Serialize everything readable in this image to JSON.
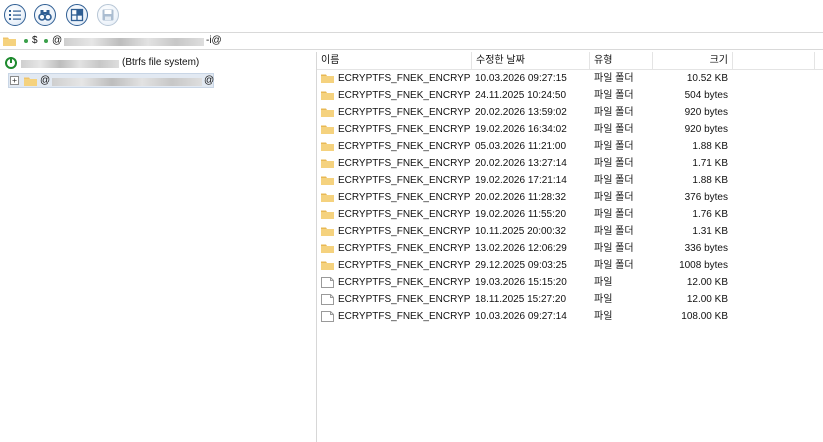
{
  "toolbar": {
    "buttons": [
      {
        "name": "list-view-button",
        "icon": "list-icon"
      },
      {
        "name": "find-button",
        "icon": "binoculars-icon"
      },
      {
        "name": "grid-view-button",
        "icon": "grid-icon"
      },
      {
        "name": "save-button",
        "icon": "floppy-disk-icon"
      }
    ]
  },
  "pathbar": {
    "separator": "$",
    "prefix": "@",
    "suffix": "-i@"
  },
  "tree": {
    "root_label": "(Btrfs file system)",
    "child_prefix": "@",
    "child_suffix": "@"
  },
  "columns": {
    "name": "이름",
    "modified": "수정한 날짜",
    "type": "유형",
    "size": "크기"
  },
  "files": [
    {
      "name": "ECRYPTFS_FNEK_ENCRYPT...",
      "modified": "10.03.2026 09:27:15",
      "type": "파일 폴더",
      "size": "10.52 KB",
      "kind": "folder"
    },
    {
      "name": "ECRYPTFS_FNEK_ENCRYPT...",
      "modified": "24.11.2025 10:24:50",
      "type": "파일 폴더",
      "size": "504 bytes",
      "kind": "folder"
    },
    {
      "name": "ECRYPTFS_FNEK_ENCRYPT...",
      "modified": "20.02.2026 13:59:02",
      "type": "파일 폴더",
      "size": "920 bytes",
      "kind": "folder"
    },
    {
      "name": "ECRYPTFS_FNEK_ENCRYPT...",
      "modified": "19.02.2026 16:34:02",
      "type": "파일 폴더",
      "size": "920 bytes",
      "kind": "folder"
    },
    {
      "name": "ECRYPTFS_FNEK_ENCRYPT...",
      "modified": "05.03.2026 11:21:00",
      "type": "파일 폴더",
      "size": "1.88 KB",
      "kind": "folder"
    },
    {
      "name": "ECRYPTFS_FNEK_ENCRYPT...",
      "modified": "20.02.2026 13:27:14",
      "type": "파일 폴더",
      "size": "1.71 KB",
      "kind": "folder"
    },
    {
      "name": "ECRYPTFS_FNEK_ENCRYPT...",
      "modified": "19.02.2026 17:21:14",
      "type": "파일 폴더",
      "size": "1.88 KB",
      "kind": "folder"
    },
    {
      "name": "ECRYPTFS_FNEK_ENCRYPT...",
      "modified": "20.02.2026 11:28:32",
      "type": "파일 폴더",
      "size": "376 bytes",
      "kind": "folder"
    },
    {
      "name": "ECRYPTFS_FNEK_ENCRYPT...",
      "modified": "19.02.2026 11:55:20",
      "type": "파일 폴더",
      "size": "1.76 KB",
      "kind": "folder"
    },
    {
      "name": "ECRYPTFS_FNEK_ENCRYPT...",
      "modified": "10.11.2025 20:00:32",
      "type": "파일 폴더",
      "size": "1.31 KB",
      "kind": "folder"
    },
    {
      "name": "ECRYPTFS_FNEK_ENCRYPT...",
      "modified": "13.02.2026 12:06:29",
      "type": "파일 폴더",
      "size": "336 bytes",
      "kind": "folder"
    },
    {
      "name": "ECRYPTFS_FNEK_ENCRYPT...",
      "modified": "29.12.2025 09:03:25",
      "type": "파일 폴더",
      "size": "1008 bytes",
      "kind": "folder"
    },
    {
      "name": "ECRYPTFS_FNEK_ENCRYPT...",
      "modified": "19.03.2026 15:15:20",
      "type": "파일",
      "size": "12.00 KB",
      "kind": "file"
    },
    {
      "name": "ECRYPTFS_FNEK_ENCRYPT...",
      "modified": "18.11.2025 15:27:20",
      "type": "파일",
      "size": "12.00 KB",
      "kind": "file"
    },
    {
      "name": "ECRYPTFS_FNEK_ENCRYPT...",
      "modified": "10.03.2026 09:27:14",
      "type": "파일",
      "size": "108.00 KB",
      "kind": "file"
    }
  ],
  "colors": {
    "accent": "#2f5e93",
    "folder": "#f0c46a",
    "selection": "#e2e9f2"
  }
}
